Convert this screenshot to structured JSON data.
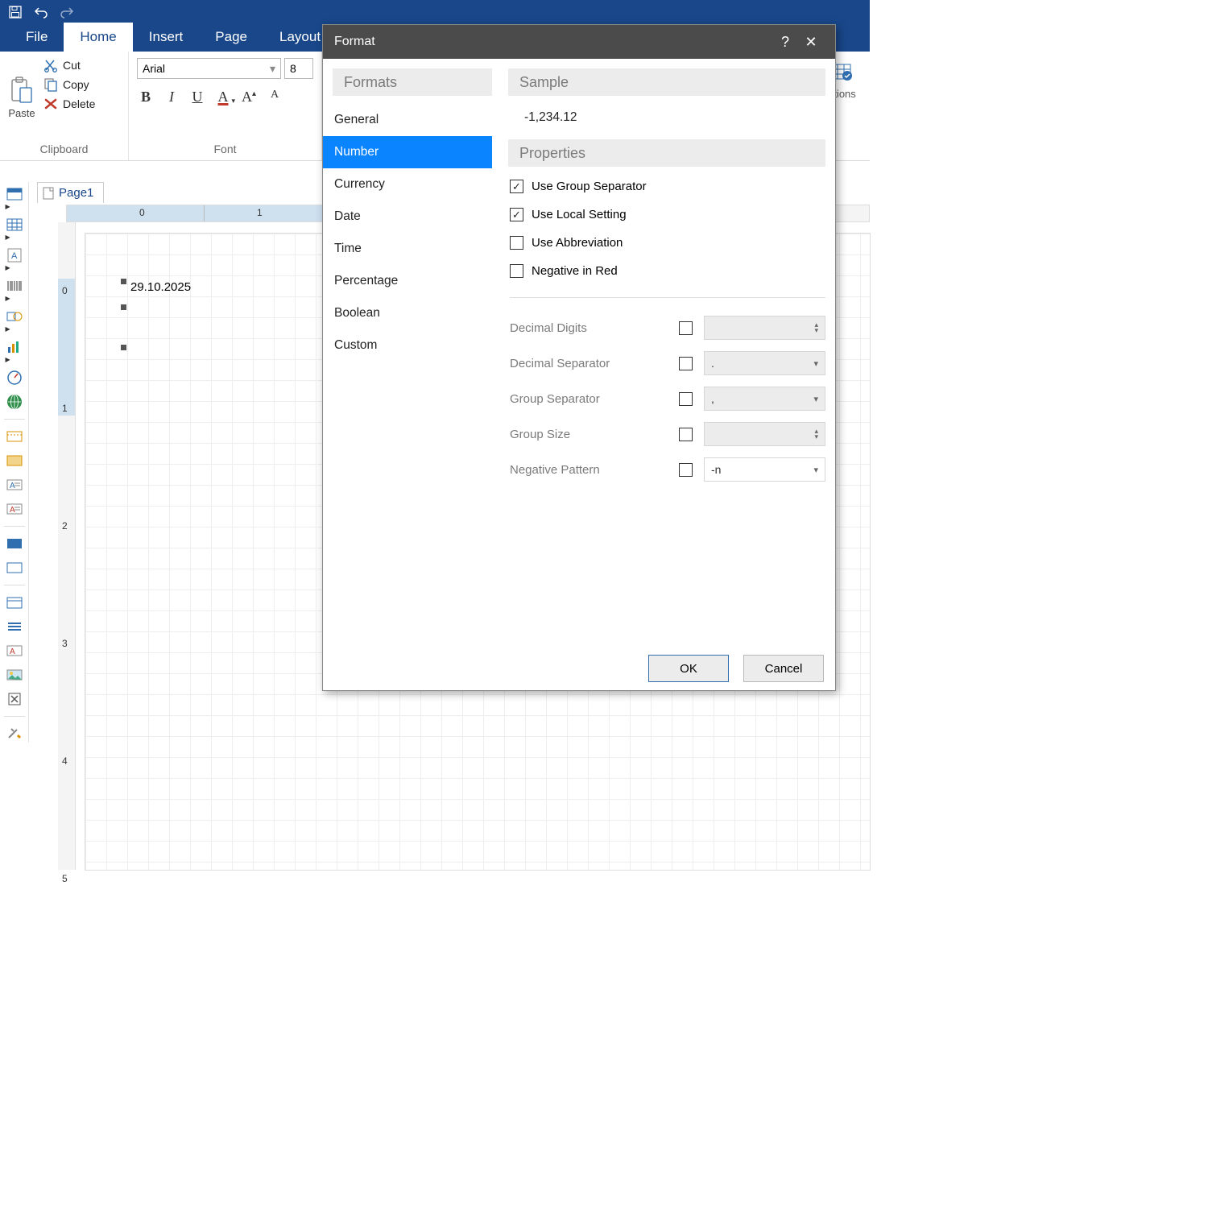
{
  "titlebar": {
    "save": "save",
    "undo": "undo",
    "redo": "redo"
  },
  "tabs": [
    "File",
    "Home",
    "Insert",
    "Page",
    "Layout"
  ],
  "active_tab": "Home",
  "clipboard": {
    "paste": "Paste",
    "cut": "Cut",
    "copy": "Copy",
    "delete": "Delete",
    "group": "Clipboard"
  },
  "font": {
    "group": "Font",
    "family": "Arial",
    "size": "8"
  },
  "right_group": {
    "label": "ditions"
  },
  "page_tab": "Page1",
  "ruler_h": [
    "0",
    "1"
  ],
  "ruler_v": [
    "0",
    "1",
    "2",
    "3",
    "4",
    "5"
  ],
  "canvas": {
    "date": "29.10.2025"
  },
  "dialog": {
    "title": "Format",
    "sections": {
      "formats": "Formats",
      "sample": "Sample",
      "properties": "Properties"
    },
    "formats": [
      "General",
      "Number",
      "Currency",
      "Date",
      "Time",
      "Percentage",
      "Boolean",
      "Custom"
    ],
    "selected_format": "Number",
    "sample_value": "-1,234.12",
    "checks": {
      "group_sep": {
        "label": "Use Group Separator",
        "checked": true
      },
      "local": {
        "label": "Use Local Setting",
        "checked": true
      },
      "abbrev": {
        "label": "Use Abbreviation",
        "checked": false
      },
      "neg_red": {
        "label": "Negative in Red",
        "checked": false
      }
    },
    "props": {
      "decimal_digits": {
        "label": "Decimal Digits",
        "value": ""
      },
      "decimal_sep": {
        "label": "Decimal Separator",
        "value": "."
      },
      "group_sep": {
        "label": "Group Separator",
        "value": ","
      },
      "group_size": {
        "label": "Group Size",
        "value": ""
      },
      "neg_pattern": {
        "label": "Negative Pattern",
        "value": "-n"
      }
    },
    "ok": "OK",
    "cancel": "Cancel"
  }
}
